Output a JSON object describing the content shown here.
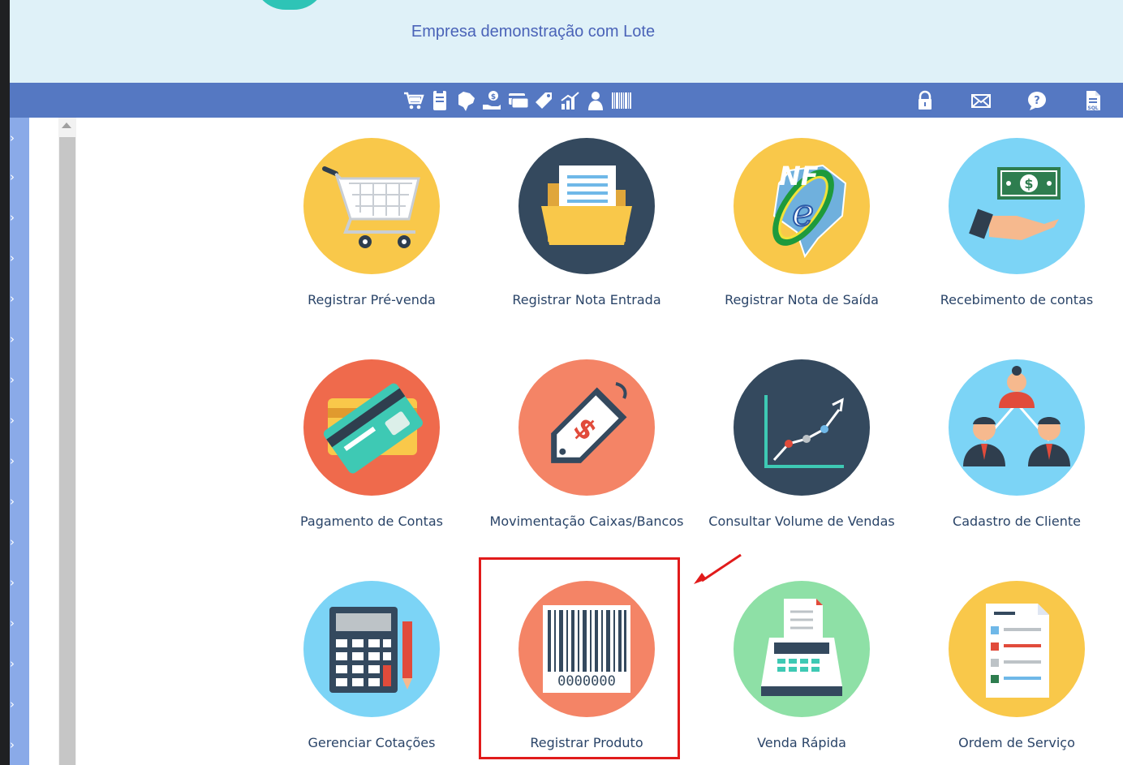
{
  "header": {
    "company_name": "Empresa demonstração com Lote"
  },
  "toolbar": {
    "left_icons": [
      "cart-icon",
      "clipboard-icon",
      "brazil-map-icon",
      "money-hand-icon",
      "payment-card-icon",
      "price-tag-icon",
      "chart-icon",
      "user-icon",
      "barcode-icon"
    ],
    "right_icons": [
      "lock-icon",
      "mail-icon",
      "help-icon",
      "sql-file-icon"
    ]
  },
  "tiles": [
    {
      "label": "Registrar Pré-venda",
      "icon": "shopping-cart-icon",
      "color": "#f9c84a"
    },
    {
      "label": "Registrar Nota Entrada",
      "icon": "folder-document-icon",
      "color": "#34495e"
    },
    {
      "label": "Registrar Nota de Saída",
      "icon": "nfe-icon",
      "color": "#f9c84a"
    },
    {
      "label": "Recebimento de contas",
      "icon": "cash-hand-icon",
      "color": "#7cd4f6"
    },
    {
      "label": "Pagamento de Contas",
      "icon": "credit-card-icon",
      "color": "#ef6a4c"
    },
    {
      "label": "Movimentação Caixas/Bancos",
      "icon": "dollar-tag-icon",
      "color": "#f48466"
    },
    {
      "label": "Consultar Volume de Vendas",
      "icon": "growth-chart-icon",
      "color": "#34495e"
    },
    {
      "label": "Cadastro de Cliente",
      "icon": "people-network-icon",
      "color": "#7cd4f6"
    },
    {
      "label": "Gerenciar Cotações",
      "icon": "calculator-icon",
      "color": "#7cd4f6"
    },
    {
      "label": "Registrar Produto",
      "icon": "barcode-icon",
      "color": "#f48466",
      "barcode_number": "0000000"
    },
    {
      "label": "Venda Rápida",
      "icon": "cash-register-icon",
      "color": "#8ee0a6"
    },
    {
      "label": "Ordem de Serviço",
      "icon": "service-order-icon",
      "color": "#f9c84a"
    }
  ],
  "annotation": {
    "highlight_color": "#e11b1b",
    "highlighted_tile": "Registrar Produto"
  }
}
